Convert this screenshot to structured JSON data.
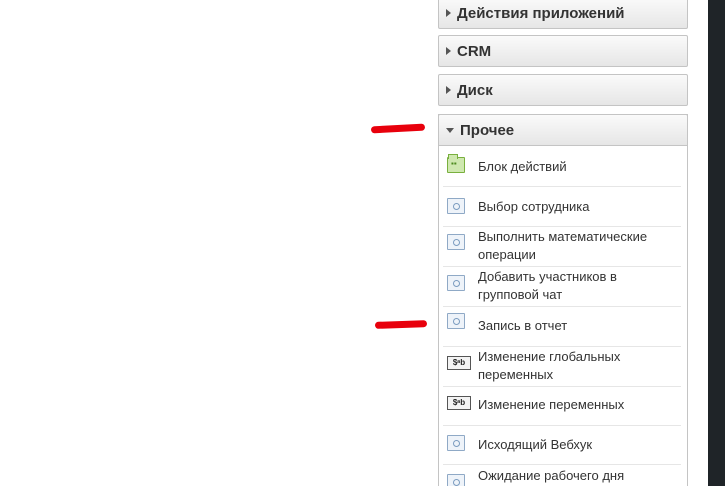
{
  "sections": {
    "app_actions": "Действия приложений",
    "crm": "CRM",
    "disk": "Диск",
    "other": "Прочее"
  },
  "other_items": [
    {
      "label": "Блок действий",
      "icon": "folder-icon"
    },
    {
      "label": "Выбор сотрудника",
      "icon": "activity-icon"
    },
    {
      "label": "Выполнить математические операции",
      "icon": "activity-icon"
    },
    {
      "label": "Добавить участников в групповой чат",
      "icon": "activity-icon"
    },
    {
      "label": "Запись в отчет",
      "icon": "activity-icon"
    },
    {
      "label": "Изменение глобальных переменных",
      "icon": "variables-icon"
    },
    {
      "label": "Изменение переменных",
      "icon": "variables-icon"
    },
    {
      "label": "Исходящий Вебхук",
      "icon": "activity-icon"
    },
    {
      "label": "Ожидание рабочего дня",
      "icon": "activity-icon"
    }
  ],
  "icon_texts": {
    "variables": "$ᵃb"
  },
  "colors": {
    "annotation_red": "#e8000c",
    "header_text": "#333333"
  }
}
